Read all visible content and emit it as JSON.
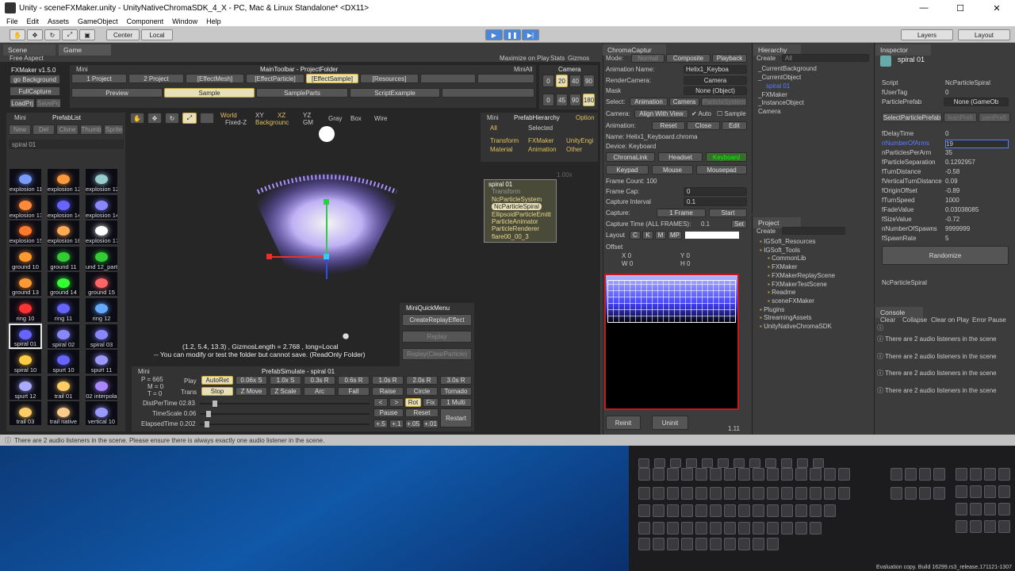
{
  "window": {
    "title": "Unity - sceneFXMaker.unity - UnityNativeChromaSDK_4_X - PC, Mac & Linux Standalone* <DX11>",
    "minimize": "—",
    "maximize": "☐",
    "close": "✕"
  },
  "menu": [
    "File",
    "Edit",
    "Assets",
    "GameObject",
    "Component",
    "Window",
    "Help"
  ],
  "toolbar": {
    "center": "Center",
    "local": "Local",
    "layers": "Layers",
    "layout": "Layout"
  },
  "tabs": {
    "scene": "Scene",
    "game": "Game",
    "aspect": "Free Aspect",
    "max_on_play": "Maximize on Play",
    "stats": "Stats",
    "gizmos": "Gizmos"
  },
  "fxmaker": {
    "version": "FXMaker v1.5.0",
    "mini": "Mini",
    "go_bg": "go Background",
    "full_capture": "FullCapture",
    "load_prj": "LoadPrj",
    "save_prj": "SavePrj",
    "main_toolbar": "MainToolbar - ProjectFolder",
    "mini_all": "MiniAll",
    "folders": [
      "1 Project",
      "2 Project",
      "[EffectMesh]",
      "[EffectParticle]",
      "[EffectSample]",
      "[Resources]"
    ],
    "folders2": [
      "Preview",
      "Sample",
      "SampleParts",
      "ScriptExample"
    ],
    "camera": "Camera",
    "cam_a": [
      "0",
      "20",
      "40",
      "90"
    ],
    "cam_b": [
      "0",
      "45",
      "90",
      "180"
    ]
  },
  "prefablist": {
    "mini": "Mini",
    "title": "PrefabList",
    "buttons": [
      "New",
      "Del",
      "Clone",
      "Thumb",
      "Sprite"
    ],
    "search": "spiral 01",
    "items": [
      "explosion 11",
      "explosion 12",
      "explosion 12",
      "explosion 13",
      "explosion 14",
      "explosion 14",
      "explosion 15",
      "explosion 16",
      "explosion 17",
      "ground 10",
      "ground 11",
      "und 12_part",
      "ground 13",
      "ground 14",
      "ground 15",
      "ring 10",
      "ring 11",
      "ring 12",
      "spiral 01",
      "spiral 02",
      "spiral 03",
      "spiral 10",
      "spurt 10",
      "spurt 11",
      "spurt 12",
      "trail 01",
      "02 interpola",
      "trail 03",
      "trail native",
      "vertical 10"
    ]
  },
  "scene": {
    "world": "World",
    "fixedz": "Fixed-Z",
    "xy": "XY",
    "xz": "XZ",
    "yz": "YZ",
    "background": "Backgrounc",
    "gm": "GM",
    "gray": "Gray",
    "box": "Box",
    "wire": "Wire",
    "info1": "(1.2, 5.4, 13.3) , GizmosLength = 2.768 , long=Local",
    "info2": "-- You can modify or test the folder but cannot save. (ReadOnly Folder)"
  },
  "quickmenu": {
    "title": "MiniQuickMenu",
    "b1": "CreateReplayEffect",
    "b2": "Replay",
    "b3": "Replay(ClearParticle)"
  },
  "simulate": {
    "mini": "Mini",
    "title": "PrefabSimulate - spiral 01",
    "p": "P = 665",
    "m": "M = 0",
    "t": "T = 0",
    "play": "Play",
    "play_btns": [
      "AutoRet",
      "0.06x S",
      "1.0x S",
      "0.3s R",
      "0.6s R",
      "1.0s R",
      "2.0s R",
      "3.0s R"
    ],
    "trans": "Trans",
    "trans_btns": [
      "Stop",
      "Z Move",
      "Z Scale",
      "Arc",
      "Fall",
      "Raise",
      "Circle",
      "Tornado"
    ],
    "dist": "DistPerTime 02.83",
    "timescale": "TimeScale 0.06",
    "elapsed": "ElapsedTime 0.202",
    "r1": [
      "<",
      ">",
      "Rot",
      "Fix",
      "1 Multi"
    ],
    "r2": [
      "Pause",
      "Reset"
    ],
    "restart": "Restart",
    "r3": [
      "+.5",
      "+.1",
      "+.05",
      "+.01"
    ]
  },
  "prefabhier": {
    "mini": "Mini",
    "title": "PrefabHierarchy",
    "option": "Option",
    "all": "All",
    "selected": "Selected",
    "filters": [
      "Transform",
      "FXMaker",
      "UnityEngi",
      "Material",
      "Animation",
      "Other"
    ],
    "nodes": [
      "spiral 01",
      "Transform",
      "NcParticleSystem",
      "NcParticleSpiral",
      "EllipsoidParticleEmitt",
      "ParticleAnimator",
      "ParticleRenderer",
      "flare00_00_3"
    ],
    "scale": "1.00x"
  },
  "chroma": {
    "tab": "ChromaCaptur",
    "mode": "Mode:",
    "modes": [
      "Normal",
      "Composite",
      "Playback"
    ],
    "anim_name_label": "Animation Name:",
    "anim_name": "Helix1_Keyboa",
    "render_cam_label": "RenderCamera:",
    "render_cam": "Camera",
    "mask_label": "Mask",
    "mask": "None (Object)",
    "select_label": "Select:",
    "select": [
      "Animation",
      "Camera",
      "ParticleSystem"
    ],
    "camera_label": "Camera:",
    "align": "Align With View",
    "auto": "Auto",
    "sample": "Sample",
    "animation_label": "Animation:",
    "anim_btns": [
      "Reset",
      "Close",
      "Edit"
    ],
    "name": "Name: Helix1_Keyboard.chroma",
    "device": "Device: Keyboard",
    "devs": [
      "ChromaLink",
      "Headset",
      "Keyboard",
      "Keypad",
      "Mouse",
      "Mousepad"
    ],
    "frame_count": "Frame Count: 100",
    "frame_cap_label": "Frame Cap:",
    "frame_cap": "0",
    "cap_int_label": "Capture Interval",
    "cap_int": "0.1",
    "capture_label": "Capture:",
    "one_frame": "1 Frame",
    "start": "Start",
    "capture_time": "Capture Time (ALL FRAMES):",
    "capture_time_val": "0.1",
    "set": "Set",
    "layout_label": "Layout",
    "layout_btns": [
      "C",
      "K",
      "M",
      "MP"
    ],
    "offset": "Offset",
    "x": "X",
    "xv": "0",
    "y": "Y",
    "yv": "0",
    "w": "W",
    "wv": "0",
    "h": "H",
    "hv": "0",
    "reinit": "Reinit",
    "uninit": "Uninit",
    "version": "1.11"
  },
  "hierarchy": {
    "tab": "Hierarchy",
    "create": "Create",
    "search": "All",
    "items": [
      "_CurrentBackground",
      "_CurrentObject",
      "spiral 01",
      "_FXMaker",
      "_InstanceObject",
      "Camera"
    ]
  },
  "project": {
    "tab": "Project",
    "create": "Create",
    "items": [
      "IGSoft_Resources",
      "IGSoft_Tools",
      "CommonLib",
      "FXMaker",
      "FXMakerReplayScene",
      "FXMakerTestScene",
      "Readme",
      "sceneFXMaker",
      "Plugins",
      "StreamingAssets",
      "UnityNativeChromaSDK"
    ]
  },
  "inspector": {
    "tab": "Inspector",
    "object": "spiral 01",
    "script_label": "Script",
    "script": "NcParticleSpiral",
    "fuser_label": "fUserTag",
    "fuser": "0",
    "pprefab_label": "ParticlePrefab",
    "pprefab": "None (GameOb",
    "btns": [
      "SelectParticlePrefab",
      "leanPrefi",
      "penPrefi"
    ],
    "fields": [
      [
        "fDelayTime",
        "0"
      ],
      [
        "nNumberOfArms",
        "19"
      ],
      [
        "nParticlesPerArm",
        "35"
      ],
      [
        "fParticleSeparation",
        "0.1292957"
      ],
      [
        "fTurnDistance",
        "-0.58"
      ],
      [
        "fVerticalTurnDistance",
        "0.09"
      ],
      [
        "fOriginOffset",
        "-0.89"
      ],
      [
        "fTurnSpeed",
        "1000"
      ],
      [
        "fFadeValue",
        "0.03038085"
      ],
      [
        "fSizeValue",
        "-0.72"
      ],
      [
        "nNumberOfSpawns",
        "9999999"
      ],
      [
        "fSpawnRate",
        "5"
      ]
    ],
    "randomize": "Randomize",
    "footer": "NcParticleSpiral"
  },
  "console": {
    "tab": "Console",
    "btns": [
      "Clear",
      "Collapse",
      "Clear on Play",
      "Error Pause"
    ],
    "msg": "There are 2 audio listeners in the scene"
  },
  "status": "There are 2 audio listeners in the scene. Please ensure there is always exactly one audio listener in the scene.",
  "eval": "Evaluation copy. Build 16299.rs3_release.171121-1307"
}
